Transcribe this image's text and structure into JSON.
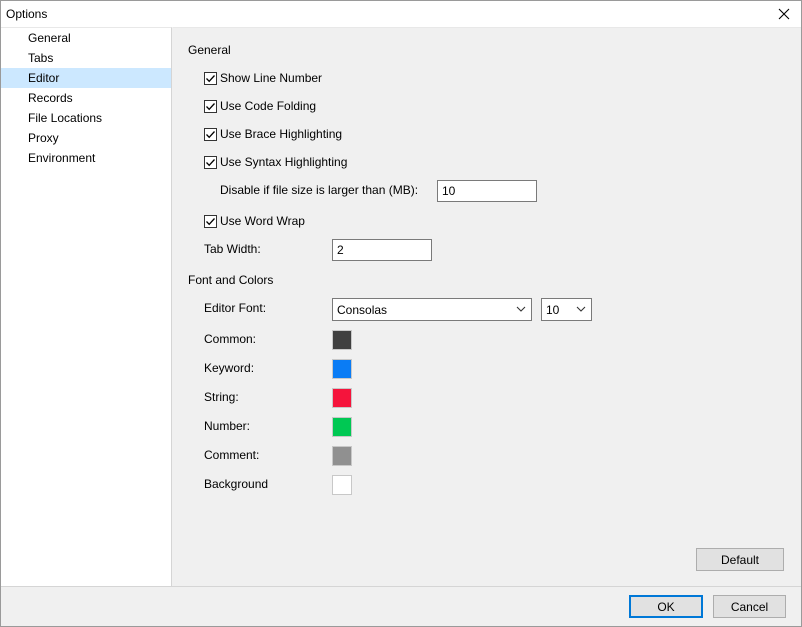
{
  "window": {
    "title": "Options"
  },
  "sidebar": {
    "items": [
      {
        "label": "General",
        "selected": false
      },
      {
        "label": "Tabs",
        "selected": false
      },
      {
        "label": "Editor",
        "selected": true
      },
      {
        "label": "Records",
        "selected": false
      },
      {
        "label": "File Locations",
        "selected": false
      },
      {
        "label": "Proxy",
        "selected": false
      },
      {
        "label": "Environment",
        "selected": false
      }
    ]
  },
  "general": {
    "heading": "General",
    "show_line_number": {
      "label": "Show Line Number",
      "checked": true
    },
    "use_code_folding": {
      "label": "Use Code Folding",
      "checked": true
    },
    "use_brace_highlighting": {
      "label": "Use Brace Highlighting",
      "checked": true
    },
    "use_syntax_highlighting": {
      "label": "Use Syntax Highlighting",
      "checked": true
    },
    "disable_size_label": "Disable if file size is larger than (MB):",
    "disable_size_value": "10",
    "use_word_wrap": {
      "label": "Use Word Wrap",
      "checked": true
    },
    "tab_width_label": "Tab Width:",
    "tab_width_value": "2"
  },
  "font_colors": {
    "heading": "Font and Colors",
    "editor_font_label": "Editor Font:",
    "editor_font_value": "Consolas",
    "font_size_value": "10",
    "colors": [
      {
        "label": "Common:",
        "color": "#404040"
      },
      {
        "label": "Keyword:",
        "color": "#0a7cf5"
      },
      {
        "label": "String:",
        "color": "#f5143c"
      },
      {
        "label": "Number:",
        "color": "#00c853"
      },
      {
        "label": "Comment:",
        "color": "#909090"
      },
      {
        "label": "Background",
        "color": "#ffffff"
      }
    ]
  },
  "buttons": {
    "default_label": "Default",
    "ok_label": "OK",
    "cancel_label": "Cancel"
  },
  "icons": {
    "close": "close-icon",
    "check": "check-icon",
    "chevron": "chevron-down-icon"
  }
}
